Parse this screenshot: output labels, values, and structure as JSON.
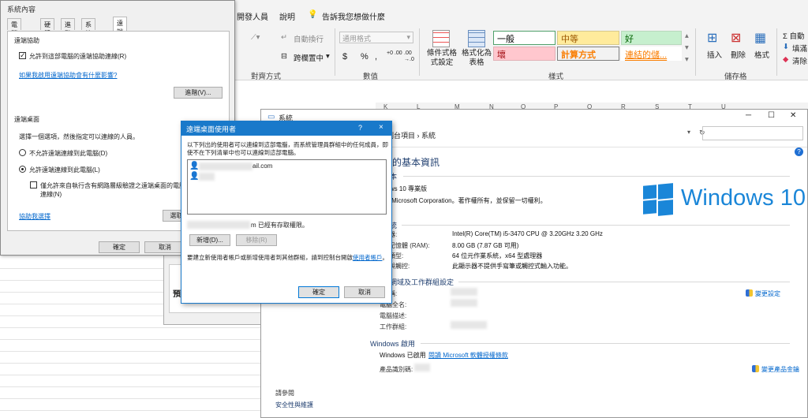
{
  "excel": {
    "tabs": {
      "developer": "開發人員",
      "help": "說明",
      "tell_me": "告訴我您想做什麼"
    },
    "alignment": {
      "wrap_text": "自動換行",
      "merge_center": "跨欄置中",
      "group_label": "對齊方式"
    },
    "number": {
      "format_value": "通用格式",
      "currency": "$",
      "percent": "%",
      "comma": ",",
      "inc_decimal": "+0 .00",
      "dec_decimal": ".00 →.0",
      "group_label": "數值"
    },
    "styles": {
      "conditional_format": "條件式格式設定",
      "format_as_table": "格式化為表格",
      "cells": [
        {
          "label": "一般",
          "bg": "#ffffff",
          "fg": "#000000",
          "border": "#4fa06a"
        },
        {
          "label": "中等",
          "bg": "#ffeb9c",
          "fg": "#9c5700",
          "border": "#d7c98a"
        },
        {
          "label": "好",
          "bg": "#c6efce",
          "fg": "#006100",
          "border": "#b9d8bd"
        },
        {
          "label": "壞",
          "bg": "#ffc7ce",
          "fg": "#9c0006",
          "border": "#e2b1b7"
        },
        {
          "label": "計算方式",
          "bg": "#f2f2f2",
          "fg": "#fa7d00",
          "border": "#7f7f7f"
        },
        {
          "label": "連結的儲...",
          "bg": "#ffffff",
          "fg": "#fa7d00",
          "border": "#ffffff"
        }
      ],
      "group_label": "樣式"
    },
    "cells_group": {
      "insert": "插入",
      "delete": "刪除",
      "format": "格式",
      "group_label": "儲存格"
    },
    "editing": {
      "sum": "Σ 自動",
      "fill": "填滿",
      "clear": "清除"
    },
    "grid_cols": [
      "K",
      "L",
      "M",
      "N",
      "O",
      "P",
      "Q",
      "R",
      "S",
      "T",
      "U"
    ]
  },
  "sysprop": {
    "title": "系統內容",
    "tabs": [
      "電腦名稱",
      "硬體",
      "進階",
      "系統保護",
      "遠端"
    ],
    "remote_assist_header": "遠端協助",
    "allow_assist": "允許到這部電腦的遠端協助連線(R)",
    "assist_link": "如果我啟用遠端協助會有什麼影響?",
    "advanced_btn": "進階(V)...",
    "remote_desktop_header": "遠端桌面",
    "choose_option": "選擇一個選項，然後指定可以連線的人員。",
    "dont_allow": "不允許遠端連線到此電腦(D)",
    "allow": "允許遠端連線到此電腦(L)",
    "nla_line1": "僅允許來自執行含有網路層級驗證之遠端桌面的電腦進行",
    "nla_line2": "連線(N)",
    "help_link": "協助我選擇",
    "select_users_btn": "選取使用者(S)...",
    "ok": "確定",
    "cancel": "取消",
    "preview": "預"
  },
  "rdu": {
    "title": "遠端桌面使用者",
    "help": "?",
    "close": "×",
    "desc": "以下列出的使用者可以連線到這部電腦，而系統管理員群組中的任何成員，即使不在下列清單中也可以連線到這部電腦。",
    "users": [
      {
        "suffix": "ail.com"
      },
      {
        "suffix": ""
      }
    ],
    "access_text": "m 已經有存取權限。",
    "add_btn": "新增(D)...",
    "remove_btn": "移除(R)",
    "footer": "要建立新使用者帳戶或新增使用者到其他群組，請到控制台開啟",
    "footer_link": "使用者帳戶",
    "footer_end": "。",
    "ok": "確定",
    "cancel": "取消"
  },
  "sysinfo": {
    "window_title": "系統",
    "breadcrumb": "控制台項目 › 系統",
    "heading": "腦的基本資訊",
    "edition_header": "版本",
    "edition": "dows 10 專業版",
    "copyright": "20 Microsoft Corporation。著作權所有，並保留一切權利。",
    "logo_text": "Windows 10",
    "system_header": "系統",
    "rows": [
      {
        "label": "理器:",
        "value": "Intel(R) Core(TM) i5-3470 CPU @ 3.20GHz   3.20 GHz"
      },
      {
        "label": "裝記憶體 (RAM):",
        "value": "8.00 GB (7.87 GB 可用)"
      },
      {
        "label": "統類型:",
        "value": "64 位元作業系統，x64 型處理器"
      },
      {
        "label": "控與觸控:",
        "value": "此顯示器不提供手寫筆或觸控式輸入功能。"
      }
    ],
    "network_header": "、網域及工作群組設定",
    "net_rows": [
      {
        "label": "名稱:"
      },
      {
        "label": "電腦全名:"
      },
      {
        "label": "電腦描述:"
      },
      {
        "label": "工作群組:"
      }
    ],
    "change_settings": "變更設定",
    "activation_header": "Windows 啟用",
    "activated": "Windows 已啟用",
    "license_link": "閱讀 Microsoft 軟體授權條款",
    "product_id_label": "產品識別碼:",
    "change_key": "變更產品金鑰",
    "see_also": "請參閱",
    "security": "安全性與維護"
  }
}
